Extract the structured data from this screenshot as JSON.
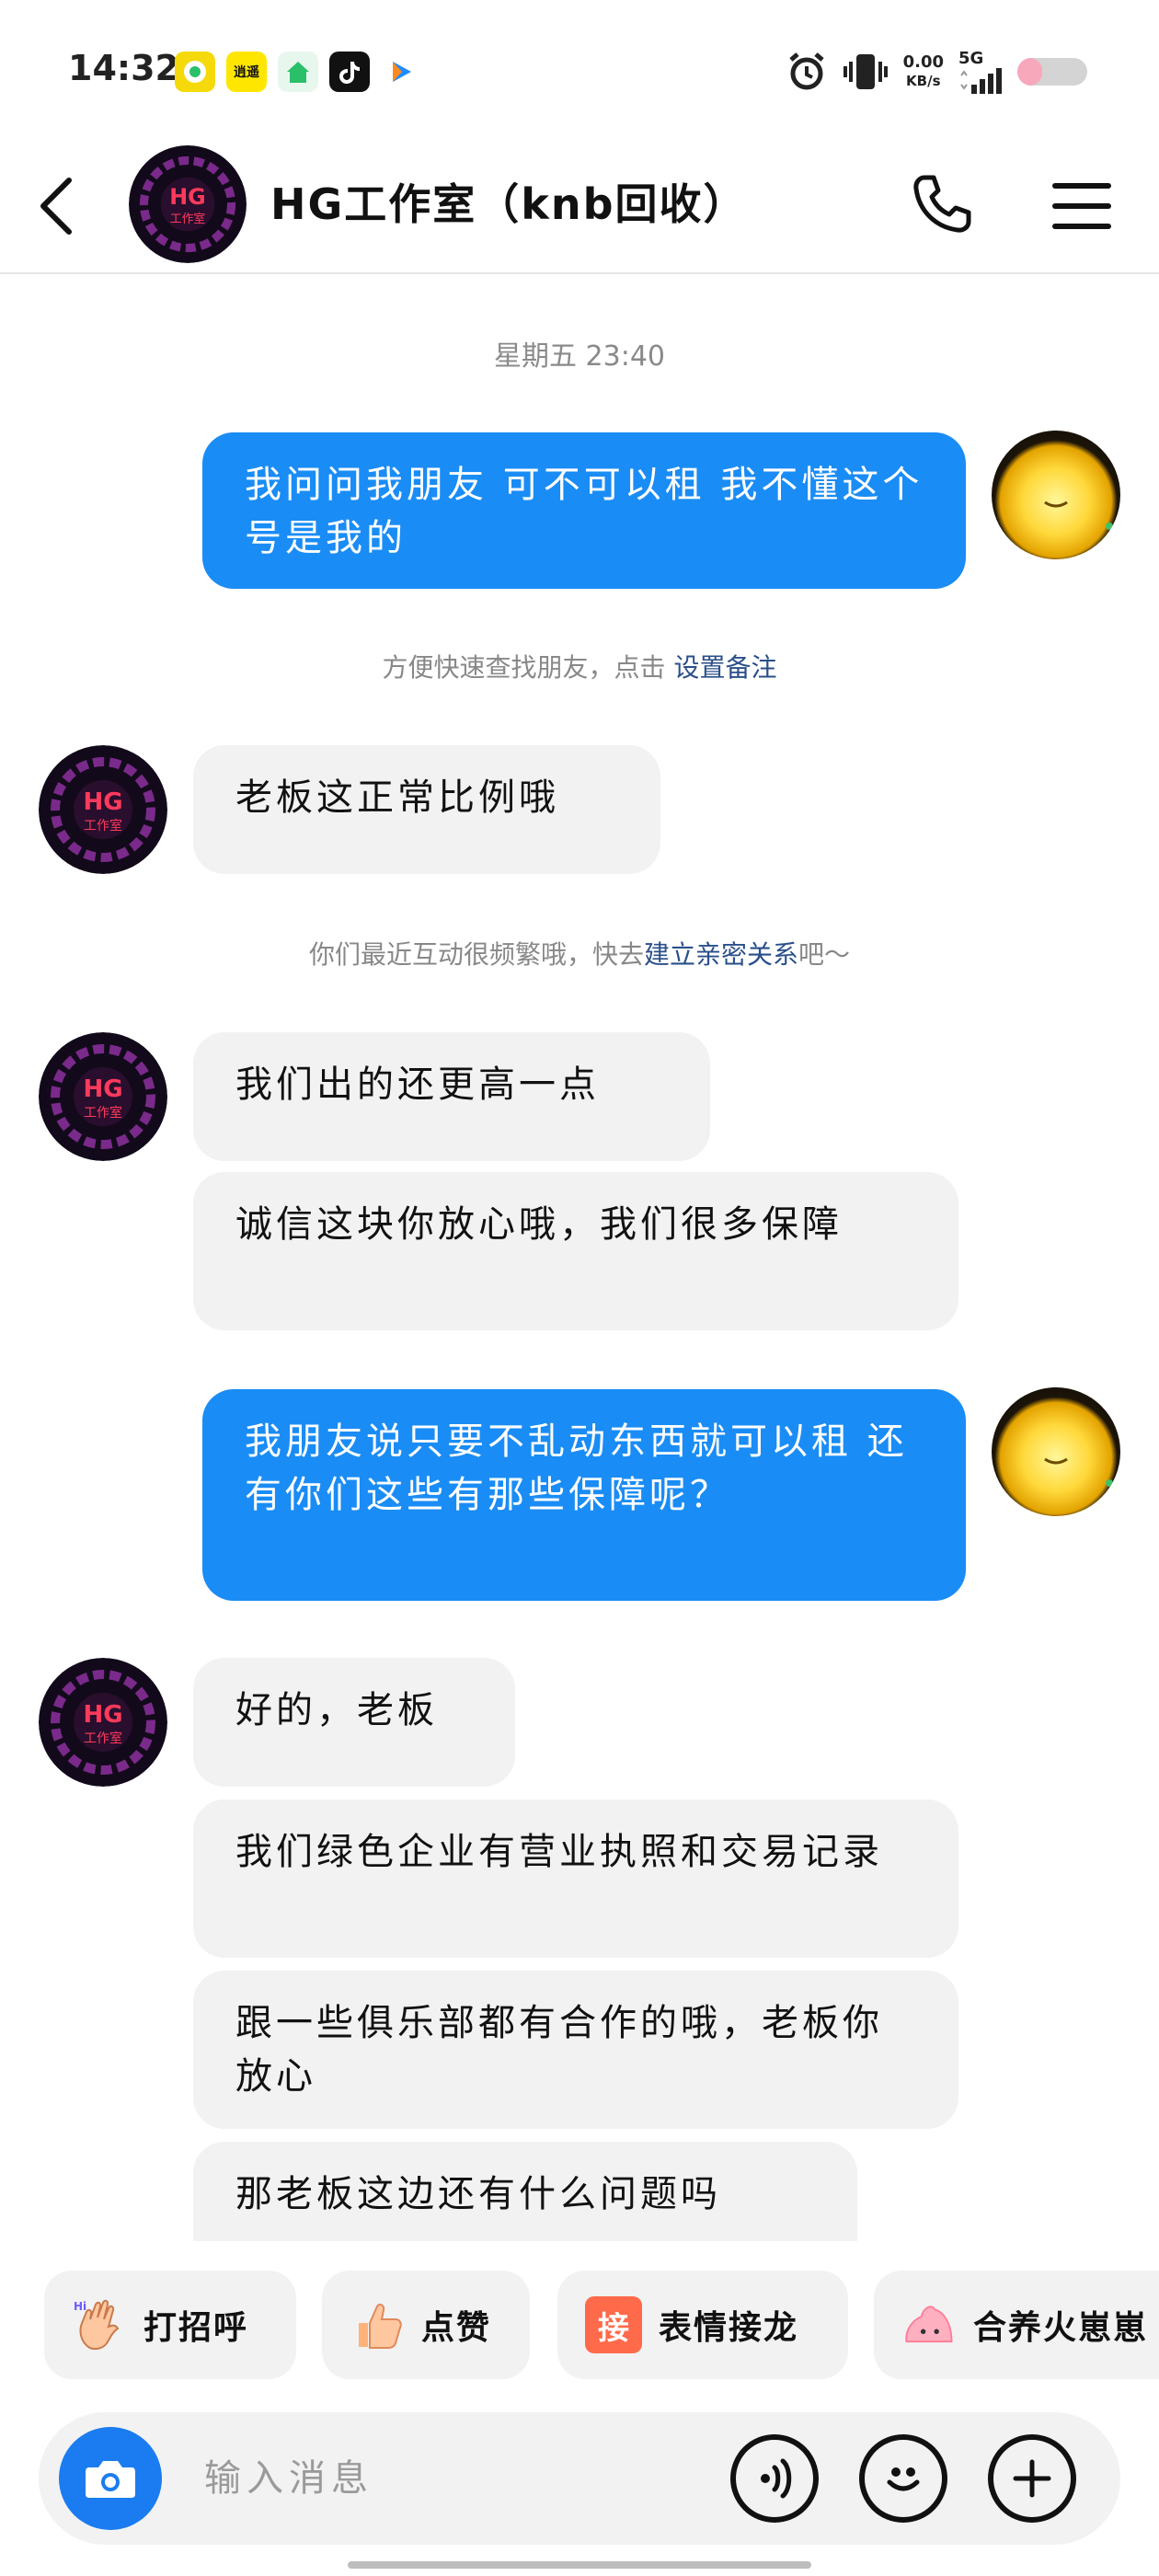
{
  "status_bar": {
    "time": "14:32",
    "apps": [
      {
        "icon": "music-app-icon",
        "color": "#f5d90a"
      },
      {
        "icon": "game-app-icon",
        "color": "#ffe600",
        "text": "逍遥"
      },
      {
        "icon": "home-app-icon",
        "color": "#2bbf6a"
      },
      {
        "icon": "tiktok-app-icon",
        "color": "#111111"
      },
      {
        "icon": "video-app-icon",
        "color": "#1e8cff"
      }
    ],
    "net_speed_value": "0.00",
    "net_speed_unit": "KB/s",
    "network": "5G",
    "battery_level": 0.35,
    "battery_color": "#f7a8bb"
  },
  "header": {
    "title": "HG工作室（knb回收）",
    "avatar_text": "HG\n工作室"
  },
  "messages": {
    "timestamp": "星期五 23:40",
    "m1": "我问问我朋友  可不可以租   我不懂这个  号是我的",
    "note1_prefix": "方便快速查找朋友，点击 ",
    "note1_link": "设置备注",
    "m2": "老板这正常比例哦",
    "note2_prefix": "你们最近互动很频繁哦，快去",
    "note2_link": "建立亲密关系",
    "note2_suffix": "吧～",
    "m3": "我们出的还更高一点",
    "m4": "诚信这块你放心哦，我们很多保障",
    "m5": "我朋友说只要不乱动东西就可以租    还有你们这些有那些保障呢？",
    "m6": "好的，老板",
    "m7": "我们绿色企业有营业执照和交易记录",
    "m8": "跟一些俱乐部都有合作的哦，老板你放心",
    "m9": "那老板这边还有什么问题吗"
  },
  "quick_replies": [
    {
      "label": "打招呼",
      "icon": "wave-hand-icon"
    },
    {
      "label": "点赞",
      "icon": "thumbs-up-icon"
    },
    {
      "label": "表情接龙",
      "icon": "emoji-chain-icon",
      "badge": "接"
    },
    {
      "label": "合养火崽崽",
      "icon": "fire-pet-icon"
    }
  ],
  "input": {
    "placeholder": "输入消息"
  },
  "colors": {
    "my_bubble": "#1a8cf5",
    "their_bubble": "#f2f2f3",
    "camera_button": "#1a7cf0",
    "link": "#2a4f8a"
  }
}
